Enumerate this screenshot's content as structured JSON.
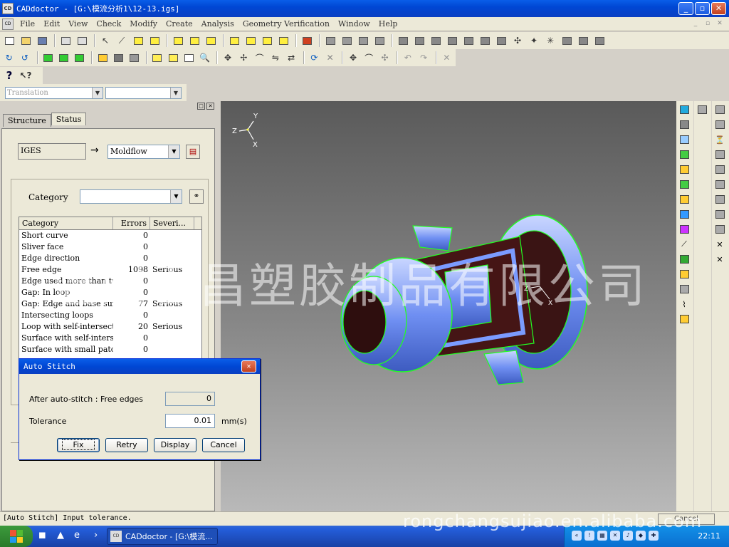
{
  "window": {
    "title": "CADdoctor - [G:\\模流分析1\\12-13.igs]",
    "app_icon": "CD",
    "controls": [
      "_",
      "▫",
      "✕"
    ]
  },
  "menu": {
    "items": [
      "File",
      "Edit",
      "View",
      "Check",
      "Modify",
      "Create",
      "Analysis",
      "Geometry Verification",
      "Window",
      "Help"
    ],
    "mdi_controls": [
      "_",
      "▫",
      "✕"
    ]
  },
  "toolbar": {
    "translation_combo": "Translation",
    "second_combo": ""
  },
  "left_panel": {
    "tabs": [
      "Structure",
      "Status"
    ],
    "active_tab": "Status",
    "source_format": "IGES",
    "target_format": "Moldflow",
    "category_label": "Category",
    "category_value": "",
    "table": {
      "headers": [
        "Category",
        "Errors",
        "Severi..."
      ],
      "rows": [
        {
          "category": "Short curve",
          "errors": "0",
          "severity": ""
        },
        {
          "category": "Sliver face",
          "errors": "0",
          "severity": ""
        },
        {
          "category": "Edge direction",
          "errors": "0",
          "severity": ""
        },
        {
          "category": "Free edge",
          "errors": "1098",
          "severity": "Serious"
        },
        {
          "category": "Edge used more than tw...",
          "errors": "0",
          "severity": ""
        },
        {
          "category": "Gap: In loop",
          "errors": "0",
          "severity": ""
        },
        {
          "category": "Gap: Edge and base surf...",
          "errors": "77",
          "severity": "Serious"
        },
        {
          "category": "Intersecting loops",
          "errors": "0",
          "severity": ""
        },
        {
          "category": "Loop with self-intersect...",
          "errors": "20",
          "severity": "Serious"
        },
        {
          "category": "Surface with self-interse...",
          "errors": "0",
          "severity": ""
        },
        {
          "category": "Surface with small patc...",
          "errors": "0",
          "severity": ""
        }
      ]
    }
  },
  "viewport": {
    "axis_labels": {
      "y": "Y",
      "z": "Z",
      "x": "X"
    },
    "model_axis": {
      "z": "Z",
      "x": "X"
    }
  },
  "dialog": {
    "title": "Auto Stitch",
    "free_edges_label": "After auto-stitch : Free edges",
    "free_edges_value": "0",
    "tolerance_label": "Tolerance",
    "tolerance_value": "0.01",
    "tolerance_unit": "mm(s)",
    "buttons": [
      "Fix",
      "Retry",
      "Display",
      "Cancel"
    ]
  },
  "watermark": {
    "text": "温州吞昌塑胶制品有限公司",
    "site": "rongchangsujiao.en.alibaba.com"
  },
  "statusbar": {
    "message": "[Auto Stitch] Input tolerance.",
    "cancel_label": "Cancel"
  },
  "taskbar": {
    "task_label": "CADdoctor - [G:\\模流...",
    "clock": "22:11"
  }
}
